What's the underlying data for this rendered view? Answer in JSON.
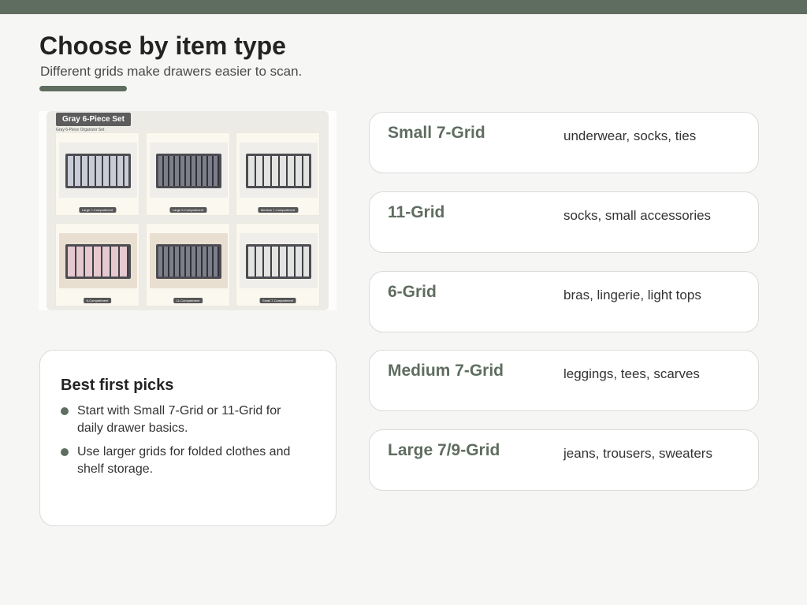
{
  "header": {
    "title": "Choose by item type",
    "subtitle": "Different grids make drawers easier to scan.",
    "accent_color": "#5f6d60"
  },
  "photo": {
    "label": "Gray 6-Piece Set",
    "caption": "Gray 6-Piece Organizer Set",
    "tiles": [
      {
        "tag": "Large 7-Compartment"
      },
      {
        "tag": "Large 9-Compartment"
      },
      {
        "tag": "Medium 7-Compartment"
      },
      {
        "tag": "6-Compartment"
      },
      {
        "tag": "11-Compartment"
      },
      {
        "tag": "Small 7-Compartment"
      }
    ]
  },
  "picks": {
    "title": "Best first picks",
    "items": [
      "Start with Small 7-Grid or 11-Grid for daily drawer basics.",
      "Use larger grids for folded clothes and shelf storage."
    ]
  },
  "grids": [
    {
      "name": "Small 7-Grid",
      "use": "underwear, socks, ties"
    },
    {
      "name": "11-Grid",
      "use": "socks, small accessories"
    },
    {
      "name": "6-Grid",
      "use": "bras, lingerie, light tops"
    },
    {
      "name": "Medium 7-Grid",
      "use": "leggings, tees, scarves"
    },
    {
      "name": "Large 7/9-Grid",
      "use": "jeans, trousers, sweaters"
    }
  ]
}
